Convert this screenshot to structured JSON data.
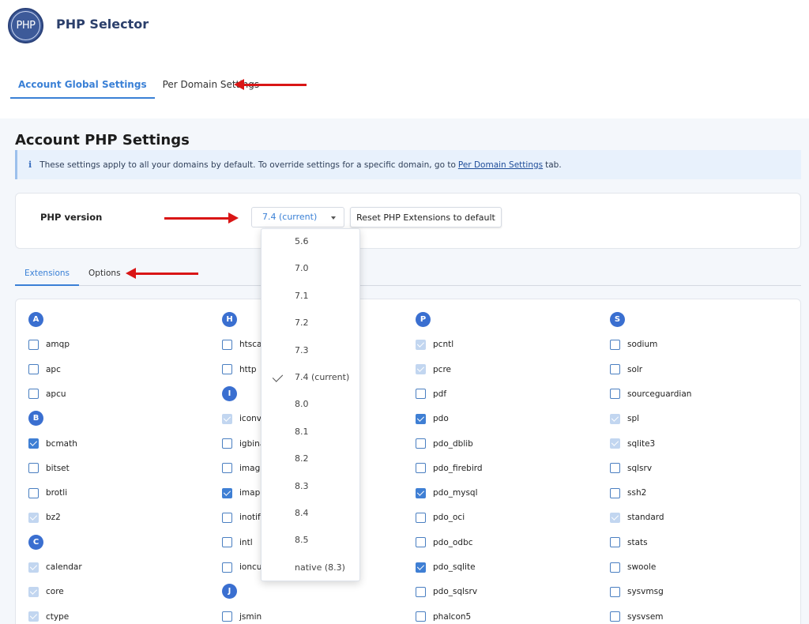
{
  "app": {
    "title": "PHP Selector",
    "logo_text": "PHP"
  },
  "top_tabs": [
    {
      "label": "Account Global Settings",
      "active": true
    },
    {
      "label": "Per Domain Settings",
      "active": false
    }
  ],
  "page": {
    "heading": "Account PHP Settings",
    "info": {
      "icon": "info-icon",
      "text_before": "These settings apply to all your domains by default. To override settings for a specific domain, go to",
      "link": "Per Domain Settings",
      "text_after": "tab."
    }
  },
  "version": {
    "label": "PHP version",
    "selected": "7.4 (current)",
    "reset_label": "Reset PHP Extensions to default",
    "options": [
      "5.6",
      "7.0",
      "7.1",
      "7.2",
      "7.3",
      "7.4 (current)",
      "8.0",
      "8.1",
      "8.2",
      "8.3",
      "8.4",
      "8.5",
      "native (8.3)"
    ]
  },
  "sub_tabs": [
    {
      "label": "Extensions",
      "active": true
    },
    {
      "label": "Options",
      "active": false
    }
  ],
  "extension_columns": [
    {
      "groups": [
        {
          "letter": "A",
          "items": [
            {
              "name": "amqp",
              "state": "unchecked"
            },
            {
              "name": "apc",
              "state": "unchecked"
            },
            {
              "name": "apcu",
              "state": "unchecked"
            }
          ]
        },
        {
          "letter": "B",
          "items": [
            {
              "name": "bcmath",
              "state": "checked"
            },
            {
              "name": "bitset",
              "state": "unchecked"
            },
            {
              "name": "brotli",
              "state": "unchecked"
            },
            {
              "name": "bz2",
              "state": "disabled"
            }
          ]
        },
        {
          "letter": "C",
          "items": [
            {
              "name": "calendar",
              "state": "disabled"
            },
            {
              "name": "core",
              "state": "disabled"
            },
            {
              "name": "ctype",
              "state": "disabled"
            }
          ]
        }
      ]
    },
    {
      "groups": [
        {
          "letter": "H",
          "items": [
            {
              "name": "htscanner",
              "state": "unchecked"
            },
            {
              "name": "http",
              "state": "unchecked"
            }
          ]
        },
        {
          "letter": "I",
          "items": [
            {
              "name": "iconv",
              "state": "disabled"
            },
            {
              "name": "igbinary",
              "state": "unchecked"
            },
            {
              "name": "imagick",
              "state": "unchecked"
            },
            {
              "name": "imap",
              "state": "checked"
            },
            {
              "name": "inotify",
              "state": "unchecked"
            },
            {
              "name": "intl",
              "state": "unchecked"
            },
            {
              "name": "ioncube_loader",
              "state": "unchecked"
            }
          ]
        },
        {
          "letter": "J",
          "items": [
            {
              "name": "jsmin",
              "state": "unchecked"
            }
          ]
        }
      ]
    },
    {
      "groups": [
        {
          "letter": "P",
          "items": [
            {
              "name": "pcntl",
              "state": "disabled"
            },
            {
              "name": "pcre",
              "state": "disabled"
            },
            {
              "name": "pdf",
              "state": "unchecked"
            },
            {
              "name": "pdo",
              "state": "checked"
            },
            {
              "name": "pdo_dblib",
              "state": "unchecked"
            },
            {
              "name": "pdo_firebird",
              "state": "unchecked"
            },
            {
              "name": "pdo_mysql",
              "state": "checked"
            },
            {
              "name": "pdo_oci",
              "state": "unchecked"
            },
            {
              "name": "pdo_odbc",
              "state": "unchecked"
            },
            {
              "name": "pdo_sqlite",
              "state": "checked"
            },
            {
              "name": "pdo_sqlsrv",
              "state": "unchecked"
            },
            {
              "name": "phalcon5",
              "state": "unchecked"
            }
          ]
        }
      ]
    },
    {
      "groups": [
        {
          "letter": "S",
          "items": [
            {
              "name": "sodium",
              "state": "unchecked"
            },
            {
              "name": "solr",
              "state": "unchecked"
            },
            {
              "name": "sourceguardian",
              "state": "unchecked"
            },
            {
              "name": "spl",
              "state": "disabled"
            },
            {
              "name": "sqlite3",
              "state": "disabled"
            },
            {
              "name": "sqlsrv",
              "state": "unchecked"
            },
            {
              "name": "ssh2",
              "state": "unchecked"
            },
            {
              "name": "standard",
              "state": "disabled"
            },
            {
              "name": "stats",
              "state": "unchecked"
            },
            {
              "name": "swoole",
              "state": "unchecked"
            },
            {
              "name": "sysvmsg",
              "state": "unchecked"
            },
            {
              "name": "sysvsem",
              "state": "unchecked"
            }
          ]
        }
      ]
    }
  ],
  "colors": {
    "accent": "#3a80d6",
    "annotation_arrow": "#d91616",
    "brand": "#3d5a99"
  }
}
